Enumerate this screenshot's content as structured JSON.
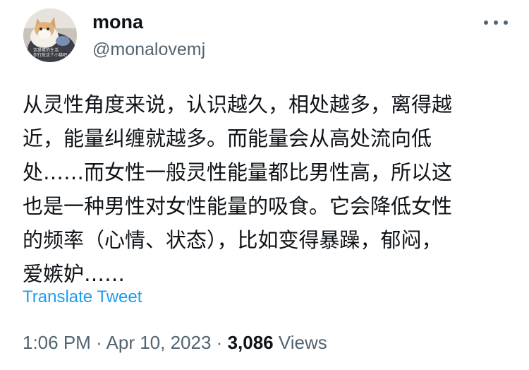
{
  "author": {
    "display_name": "mona",
    "handle": "@monalovemj",
    "avatar_icon": "cat-photo-avatar",
    "avatar_caption_lines": [
      "这操蛋的生活",
      "你行就这个小猫吧"
    ]
  },
  "more_icon": "more-horizontal-icon",
  "tweet": {
    "lines": [
      "从灵性角度来说，认识越久，相处越多，离得越",
      "近，能量纠缠就越多。而能量会从高处流向低",
      "处……而女性一般灵性能量都比男性高，所以这",
      "也是一种男性对女性能量的吸食。它会降低女性",
      "的频率（心情、状态），比如变得暴躁，郁闷，",
      "爱嫉妒……"
    ]
  },
  "translate_label": "Translate Tweet",
  "meta": {
    "time": "1:06 PM",
    "separator": "·",
    "date": "Apr 10, 2023",
    "views_count": "3,086",
    "views_label": "Views"
  },
  "colors": {
    "text_primary": "#0f1419",
    "text_secondary": "#536471",
    "link": "#1d9bf0"
  }
}
